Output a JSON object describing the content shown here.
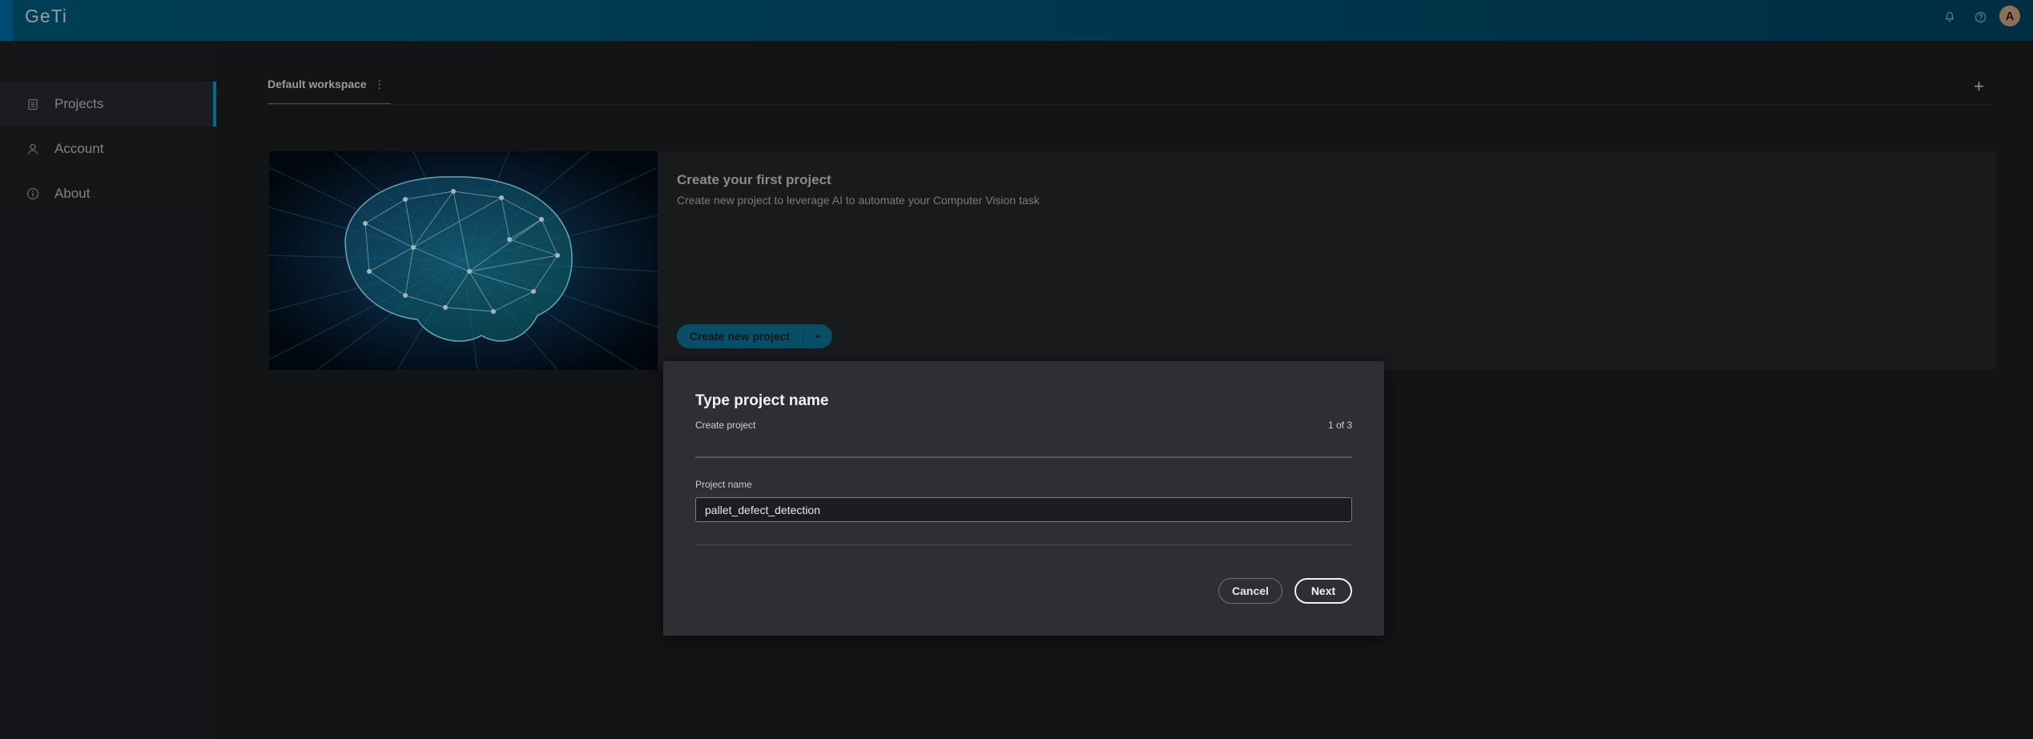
{
  "header": {
    "logo": "GeTi",
    "avatar_initial": "A"
  },
  "sidebar": {
    "items": [
      {
        "label": "Projects",
        "icon": "clipboard-icon",
        "active": true
      },
      {
        "label": "Account",
        "icon": "user-icon",
        "active": false
      },
      {
        "label": "About",
        "icon": "info-icon",
        "active": false
      }
    ]
  },
  "workspace": {
    "tab_label": "Default workspace",
    "menu_glyph": "⋮",
    "add_glyph": "+"
  },
  "card": {
    "title": "Create your first project",
    "description": "Create new project to leverage AI to automate your Computer Vision task",
    "create_button_label": "Create new project"
  },
  "dialog": {
    "title": "Type project name",
    "subtitle": "Create project",
    "step": "1 of 3",
    "field_label": "Project name",
    "field_value": "pallet_defect_detection",
    "cancel_label": "Cancel",
    "next_label": "Next"
  },
  "colors": {
    "accent": "#0094c9",
    "header": "#005778",
    "dialog_bg": "#2e2f33"
  }
}
